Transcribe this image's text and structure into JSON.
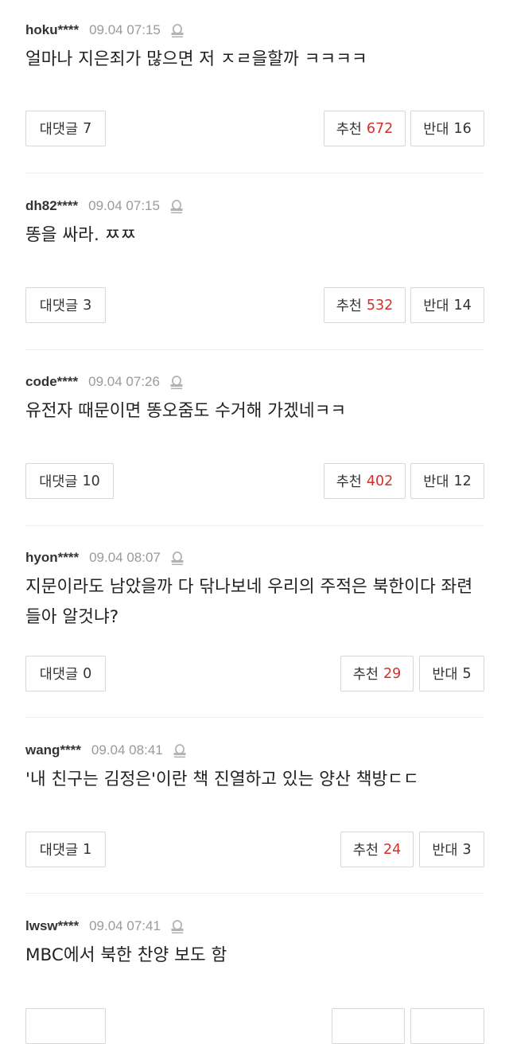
{
  "labels": {
    "reply": "대댓글",
    "like": "추천",
    "dislike": "반대"
  },
  "comments": [
    {
      "user": "hoku****",
      "time": "09.04 07:15",
      "text": "얼마나 지은죄가 많으면 저 ㅈㄹ을할까 ㅋㅋㅋㅋ",
      "replies": "7",
      "likes": "672",
      "dislikes": "16"
    },
    {
      "user": "dh82****",
      "time": "09.04 07:15",
      "text": "똥을 싸라. ㅉㅉ",
      "replies": "3",
      "likes": "532",
      "dislikes": "14"
    },
    {
      "user": "code****",
      "time": "09.04 07:26",
      "text": "유전자 때문이면 똥오줌도 수거해 가겠네ㅋㅋ",
      "replies": "10",
      "likes": "402",
      "dislikes": "12"
    },
    {
      "user": "hyon****",
      "time": "09.04 08:07",
      "text": "지문이라도 남았을까 다 닦나보네 우리의 주적은 북한이다 좌련들아 알것냐?",
      "replies": "0",
      "likes": "29",
      "dislikes": "5"
    },
    {
      "user": "wang****",
      "time": "09.04 08:41",
      "text": "'내 친구는 김정은'이란 책 진열하고 있는 양산 책방ㄷㄷ",
      "replies": "1",
      "likes": "24",
      "dislikes": "3"
    },
    {
      "user": "lwsw****",
      "time": "09.04 07:41",
      "text": "MBC에서 북한 찬양 보도 함",
      "replies": "",
      "likes": "",
      "dislikes": ""
    }
  ]
}
